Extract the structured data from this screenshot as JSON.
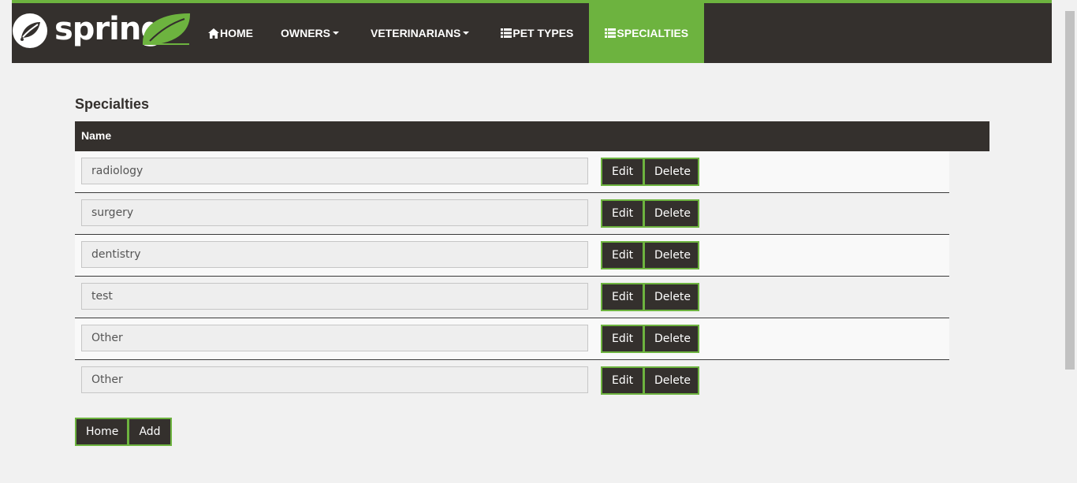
{
  "brand": {
    "name": "spring"
  },
  "nav": {
    "items": [
      {
        "label": "Home",
        "icon": "home-icon",
        "active": false,
        "dropdown": false
      },
      {
        "label": "Owners",
        "icon": "",
        "active": false,
        "dropdown": true
      },
      {
        "label": "Veterinarians",
        "icon": "",
        "active": false,
        "dropdown": true
      },
      {
        "label": "Pet Types",
        "icon": "list-icon",
        "active": false,
        "dropdown": false
      },
      {
        "label": "Specialties",
        "icon": "list-icon",
        "active": true,
        "dropdown": false
      }
    ]
  },
  "page": {
    "title": "Specialties"
  },
  "table": {
    "header": "Name",
    "rows": [
      {
        "name": "radiology"
      },
      {
        "name": "surgery"
      },
      {
        "name": "dentistry"
      },
      {
        "name": "test"
      },
      {
        "name": "Other"
      },
      {
        "name": "Other"
      }
    ],
    "edit_label": "Edit",
    "delete_label": "Delete"
  },
  "footer": {
    "home_label": "Home",
    "add_label": "Add"
  },
  "colors": {
    "accent": "#6db33f",
    "dark": "#34302d",
    "background": "#f1f1f1"
  }
}
